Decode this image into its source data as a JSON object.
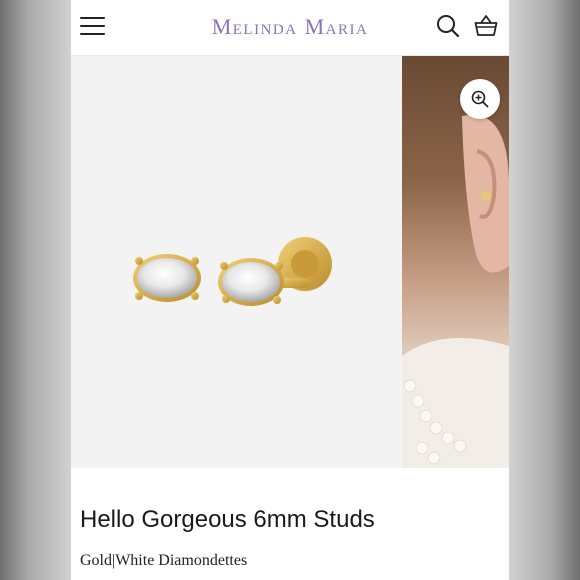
{
  "header": {
    "brand": "Melinda Maria",
    "menu_icon": "hamburger-menu-icon",
    "search_icon": "search-icon",
    "cart_icon": "shopping-basket-icon"
  },
  "gallery": {
    "zoom_icon": "zoom-in-icon",
    "colors": {
      "gold": "#d8b45a",
      "background": "#f3f3f3"
    }
  },
  "product": {
    "title": "Hello Gorgeous 6mm Studs",
    "variant": "Gold|White Diamondettes"
  }
}
